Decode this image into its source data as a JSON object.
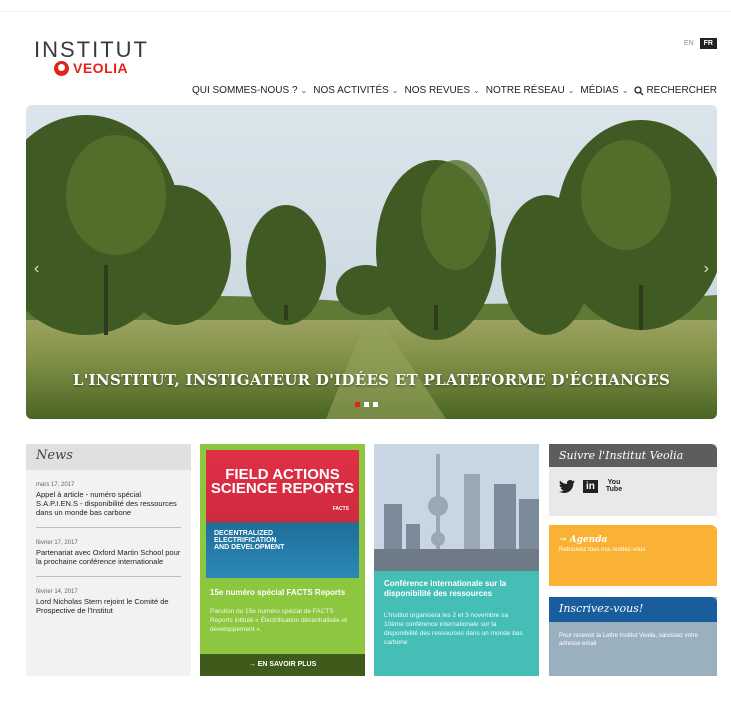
{
  "header": {
    "logo_line1": "INSTITUT",
    "logo_line2": "VEOLIA",
    "lang": [
      "EN",
      "FR"
    ],
    "nav": [
      {
        "label": "QUI SOMMES-NOUS ?",
        "chevron": "chevron-down-icon"
      },
      {
        "label": "NOS ACTIVITÉS",
        "chevron": "chevron-down-icon"
      },
      {
        "label": "NOS REVUES",
        "chevron": "chevron-down-icon"
      },
      {
        "label": "NOTRE RÉSEAU",
        "chevron": "chevron-down-icon"
      },
      {
        "label": "MÉDIAS",
        "chevron": "chevron-down-icon"
      }
    ],
    "search_label": "RECHERCHER",
    "search_icon": "search-icon"
  },
  "hero": {
    "caption": "L'INSTITUT, INSTIGATEUR D'IDÉES ET PLATEFORME D'ÉCHANGES",
    "prev_glyph": "‹",
    "next_glyph": "›",
    "slides_count": 3,
    "active_slide": 1
  },
  "news": {
    "title": "News",
    "items": [
      {
        "date": "mars 17, 2017",
        "title": "Appel à article - numéro spécial S.A.P.I.EN.S - disponibilité des ressources dans un monde bas carbone"
      },
      {
        "date": "février 17, 2017",
        "title": "Partenariat avec Oxford Martin School pour la prochaine conférence internationale"
      },
      {
        "date": "février 14, 2017",
        "title": "Lord Nicholas Stern rejoint le Comité de Prospective de l'Institut"
      }
    ]
  },
  "card_facts": {
    "cover_title": "FIELD ACTIONS\nSCIENCE REPORTS",
    "cover_badge": "FACTS",
    "cover_subtitle": "DECENTRALIZED\nELECTRIFICATION\nAND DEVELOPMENT",
    "title": "15e numéro spécial FACTS Reports",
    "text": "Parution du 15e numéro spécial de FACTS Reports intitulé « Électrification décentralisée et développement ».",
    "more": "→ EN SAVOIR PLUS"
  },
  "card_conf": {
    "title": "Conférence internationale sur la disponibilité des ressources",
    "text": "L'Institut organisera les 2 et 3 novembre sa 10ème conférence internationale sur la disponibilité des ressources dans un monde bas carbone"
  },
  "follow": {
    "title": "Suivre l'Institut Veolia",
    "icons": [
      "twitter-icon",
      "linkedin-icon",
      "youtube-icon"
    ],
    "linkedin_text": "in",
    "youtube_text": "You\nTube"
  },
  "agenda": {
    "title": "→ Agenda",
    "text": "Retrouvez tous nos rendez-vous"
  },
  "subscribe": {
    "title": "Inscrivez-vous!",
    "text": "Pour recevoir la Lettre Institut Veolia, saisissez votre adresse email"
  },
  "colors": {
    "brand_red": "#e2231a",
    "green": "#8dc63f",
    "teal": "#45bfb6",
    "orange": "#f9b233",
    "blue": "#1a5d9c"
  }
}
